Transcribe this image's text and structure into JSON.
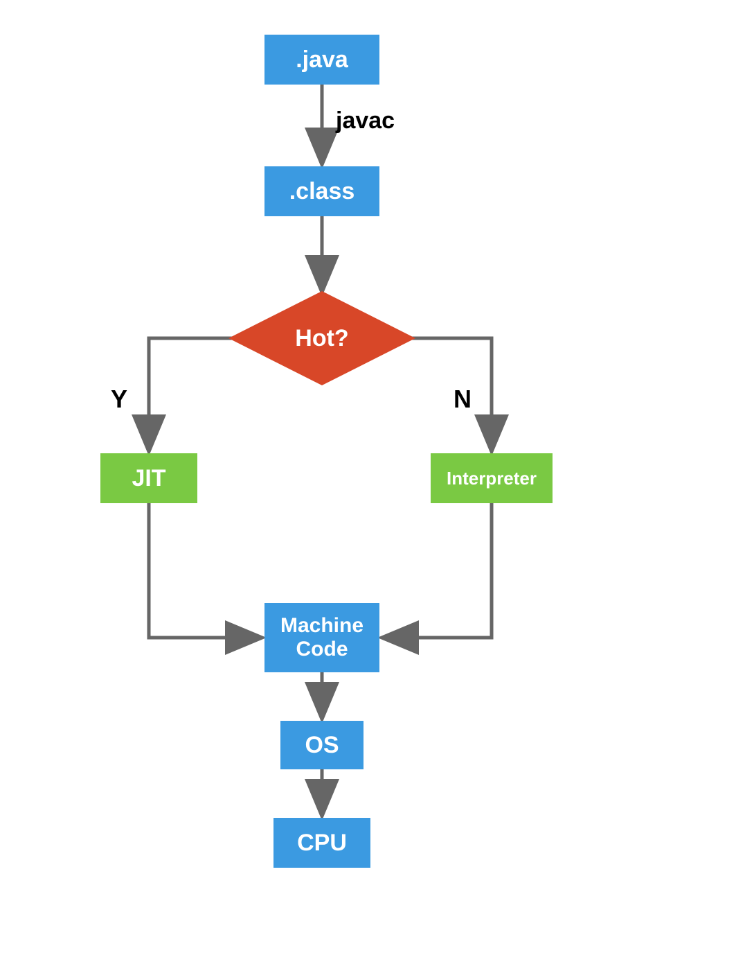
{
  "nodes": {
    "java": ".java",
    "class": ".class",
    "hot": "Hot?",
    "jit": "JIT",
    "interpreter": "Interpreter",
    "machine": "Machine Code",
    "os": "OS",
    "cpu": "CPU"
  },
  "edges": {
    "javac": "javac",
    "yes": "Y",
    "no": "N"
  },
  "colors": {
    "blue": "#3b9ae1",
    "green": "#7ac943",
    "red": "#d84728",
    "arrow": "#666666",
    "text": "#000000"
  }
}
